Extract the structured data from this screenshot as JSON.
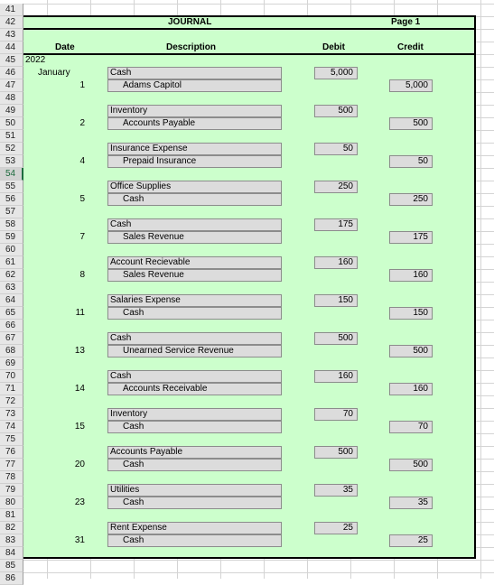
{
  "sheet": {
    "first_row": 41,
    "last_row": 86,
    "selected_row": 54,
    "fill_color": "#ccffcc",
    "selection_color": "#1d6b3e"
  },
  "header": {
    "title": "JOURNAL",
    "page": "Page 1",
    "col_date": "Date",
    "col_description": "Description",
    "col_debit": "Debit",
    "col_credit": "Credit"
  },
  "year": "2022",
  "month": "January",
  "entries": [
    {
      "day": "1",
      "debit_account": "Cash",
      "credit_account": "Adams Capitol",
      "debit": "5,000",
      "credit": "5,000"
    },
    {
      "day": "2",
      "debit_account": "Inventory",
      "credit_account": "Accounts Payable",
      "debit": "500",
      "credit": "500"
    },
    {
      "day": "4",
      "debit_account": "Insurance Expense",
      "credit_account": "Prepaid Insurance",
      "debit": "50",
      "credit": "50"
    },
    {
      "day": "5",
      "debit_account": "Office Supplies",
      "credit_account": "Cash",
      "debit": "250",
      "credit": "250"
    },
    {
      "day": "7",
      "debit_account": "Cash",
      "credit_account": "Sales Revenue",
      "debit": "175",
      "credit": "175"
    },
    {
      "day": "8",
      "debit_account": "Account Recievable",
      "credit_account": "Sales Revenue",
      "debit": "160",
      "credit": "160"
    },
    {
      "day": "11",
      "debit_account": "Salaries Expense",
      "credit_account": "Cash",
      "debit": "150",
      "credit": "150"
    },
    {
      "day": "13",
      "debit_account": "Cash",
      "credit_account": "Unearned Service Revenue",
      "debit": "500",
      "credit": "500"
    },
    {
      "day": "14",
      "debit_account": "Cash",
      "credit_account": "Accounts Receivable",
      "debit": "160",
      "credit": "160"
    },
    {
      "day": "15",
      "debit_account": "Inventory",
      "credit_account": "Cash",
      "debit": "70",
      "credit": "70"
    },
    {
      "day": "20",
      "debit_account": "Accounts Payable",
      "credit_account": "Cash",
      "debit": "500",
      "credit": "500"
    },
    {
      "day": "23",
      "debit_account": "Utilities",
      "credit_account": "Cash",
      "debit": "35",
      "credit": "35"
    },
    {
      "day": "31",
      "debit_account": "Rent Expense",
      "credit_account": "Cash",
      "debit": "25",
      "credit": "25"
    }
  ]
}
